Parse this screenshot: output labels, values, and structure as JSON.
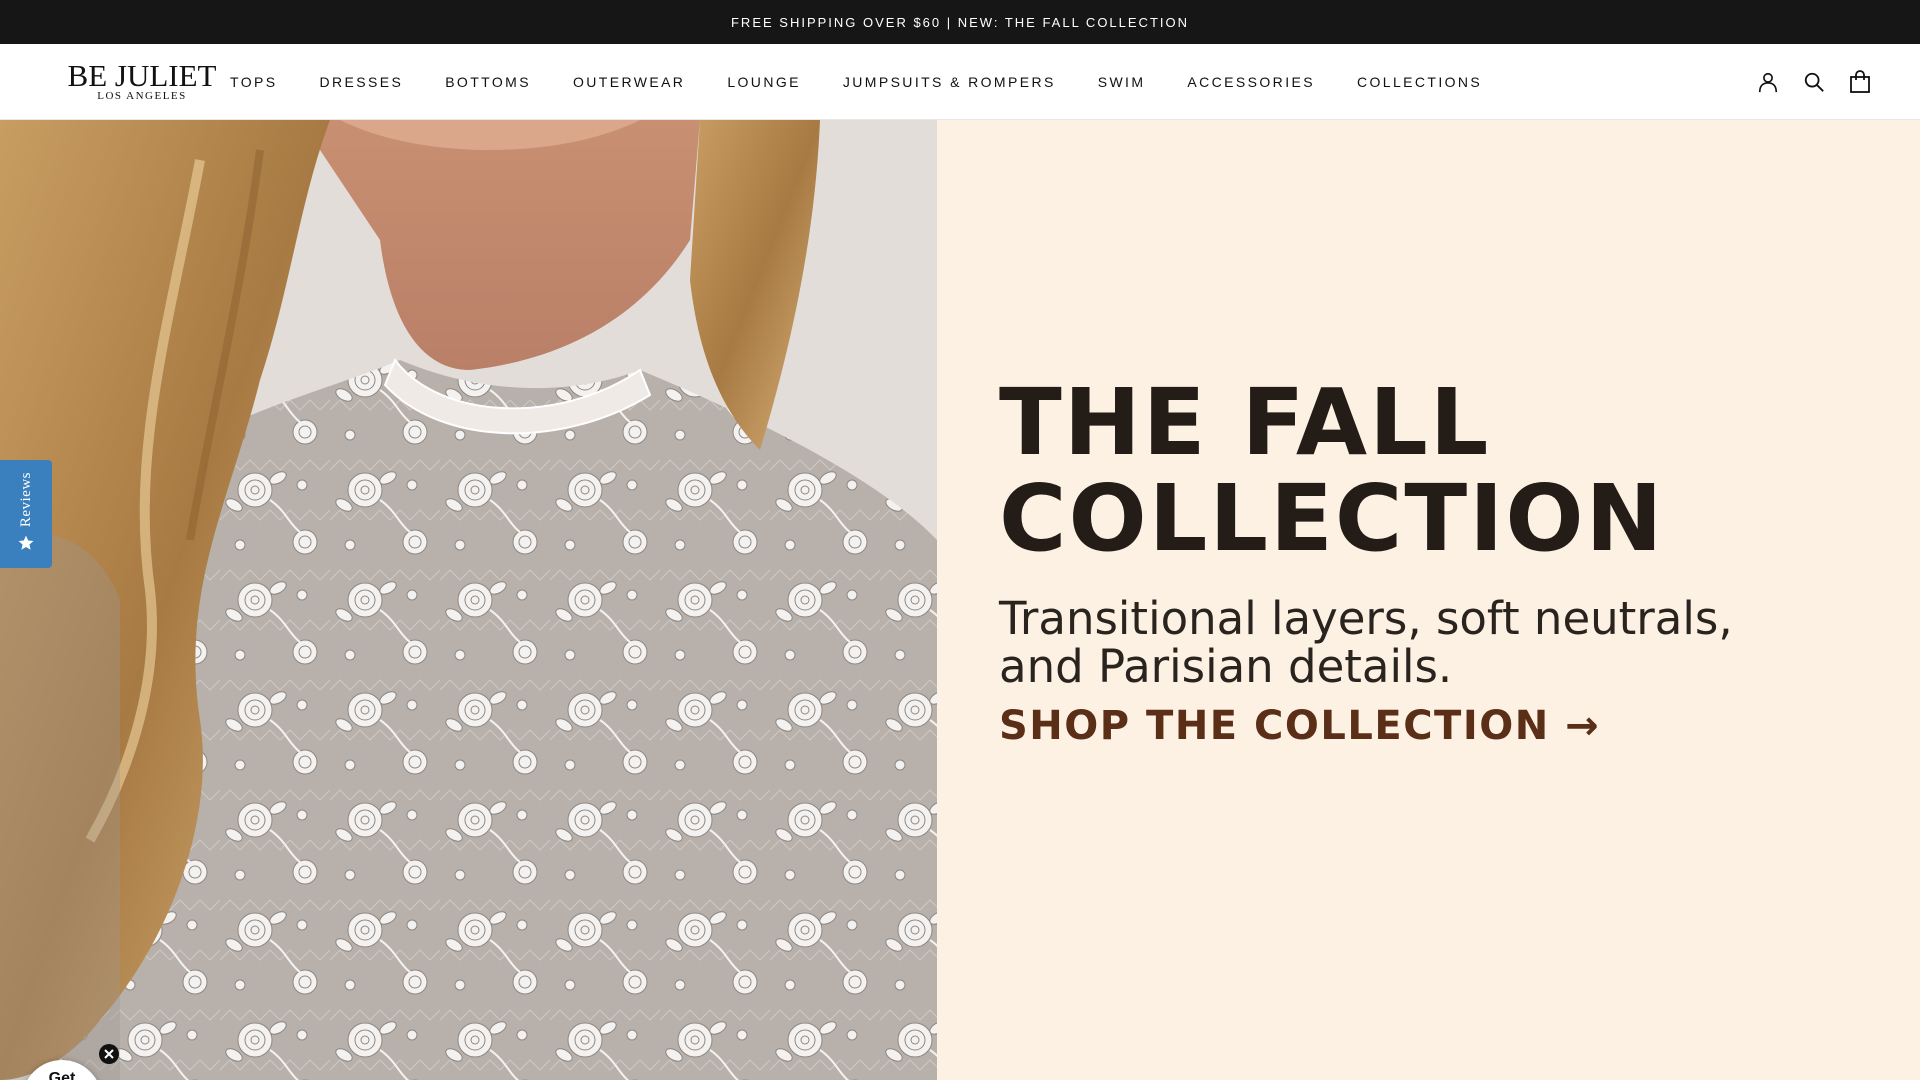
{
  "announcement": {
    "text": "FREE SHIPPING OVER $60 | NEW: THE FALL COLLECTION"
  },
  "brand": {
    "name": "BE JULIET",
    "location": "LOS ANGELES"
  },
  "nav": {
    "items": [
      {
        "label": "TOPS"
      },
      {
        "label": "DRESSES"
      },
      {
        "label": "BOTTOMS"
      },
      {
        "label": "OUTERWEAR"
      },
      {
        "label": "LOUNGE"
      },
      {
        "label": "JUMPSUITS & ROMPERS"
      },
      {
        "label": "SWIM"
      },
      {
        "label": "ACCESSORIES"
      },
      {
        "label": "COLLECTIONS"
      }
    ]
  },
  "header_icons": [
    "account-icon",
    "search-icon",
    "shopping-bag-icon"
  ],
  "hero": {
    "title_line1": "THE FALL",
    "title_line2": "COLLECTION",
    "subtitle_line1": "Transitional layers, soft neutrals,",
    "subtitle_line2": "and Parisian details.",
    "cta": "SHOP THE COLLECTION →",
    "image": "model-in-white-lace-mock-neck-top",
    "background_color": "#fdf1e4",
    "cta_color": "#5b2f17"
  },
  "reviews_tab": {
    "label": "Reviews",
    "icon": "star-icon",
    "color": "#3a7fbe"
  },
  "promo_popup": {
    "label": "Get"
  }
}
